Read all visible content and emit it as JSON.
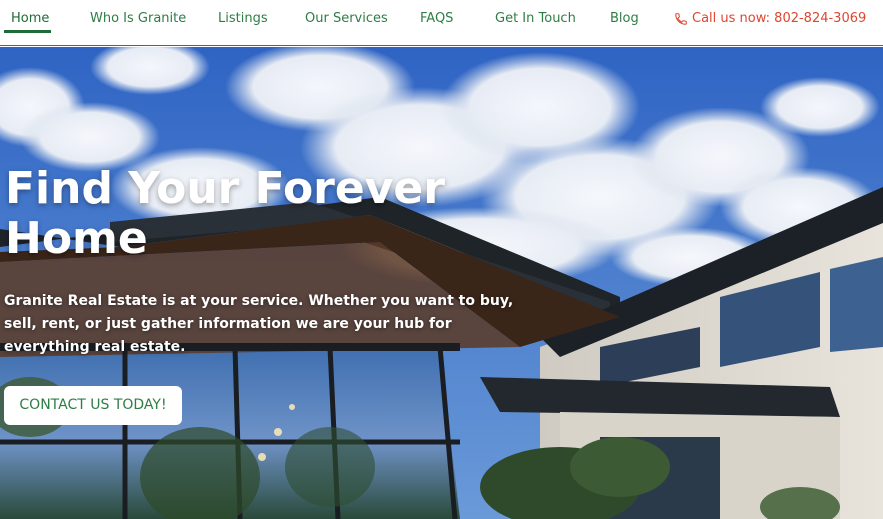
{
  "nav": {
    "items": [
      {
        "label": "Home",
        "active": true
      },
      {
        "label": "Who Is Granite"
      },
      {
        "label": "Listings"
      },
      {
        "label": "Our Services"
      },
      {
        "label": "FAQS"
      },
      {
        "label": "Get In Touch"
      },
      {
        "label": "Blog"
      }
    ],
    "call_label": "Call us now: 802-824-3069",
    "call_icon": "phone-icon"
  },
  "hero": {
    "title": "Find Your Forever Home",
    "subtitle": "Granite Real Estate is at your service. Whether you want to buy, sell, rent, or just gather information we are your hub for everything real estate.",
    "cta_label": "CONTACT US TODAY!"
  },
  "colors": {
    "accent": "#2e7d45",
    "call": "#e0452f",
    "sky": "#3c74c9"
  }
}
